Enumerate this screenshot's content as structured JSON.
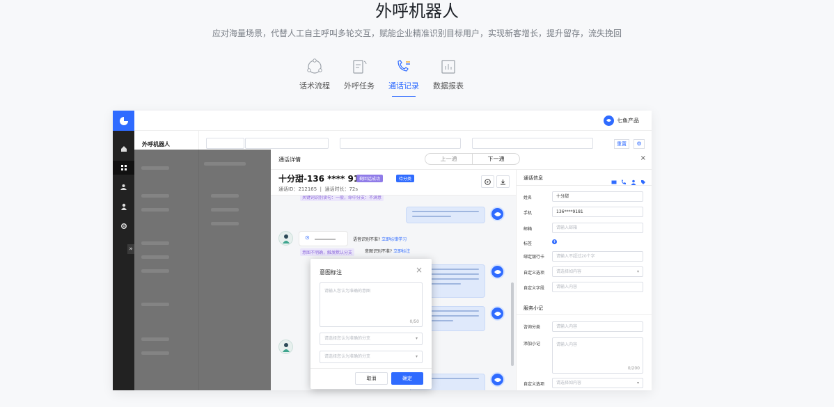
{
  "hero": {
    "title": "外呼机器人",
    "subtitle": "应对海量场景，代替人工自主呼叫多轮交互，赋能企业精准识别目标用户，实现新客增长，提升留存，流失挽回"
  },
  "feature_tabs": [
    {
      "label": "话术流程",
      "icon": "flow-icon"
    },
    {
      "label": "外呼任务",
      "icon": "task-icon"
    },
    {
      "label": "通话记录",
      "icon": "call-record-icon",
      "active": true
    },
    {
      "label": "数据报表",
      "icon": "report-icon"
    }
  ],
  "app": {
    "brand": "七鱼产品",
    "section_title": "外呼机器人",
    "reset_label": "重置",
    "accent": "#2f6bff"
  },
  "drawer": {
    "title": "通话详情",
    "prev": "上一通",
    "next": "下一通",
    "close": "×",
    "caller": "十分甜-136 **** 9181",
    "tag_identify": "剩回话成功",
    "tag_unclassified": "待分类",
    "call_id": "通话ID：212165",
    "sep": "|",
    "duration": "通话时长：72s"
  },
  "chat": {
    "keyword_tag": "关键词识别读句：一般，命中分支：不满意",
    "q1": "语音识别不准?",
    "q1_link": "立即标错学习",
    "intent_tag": "意图不明确，触发默认分支",
    "q2": "意图识别不准?",
    "q2_link": "立即标注"
  },
  "info_panel": {
    "header": "通话信息",
    "name_label": "姓名",
    "name_value": "十分甜",
    "phone_label": "手机",
    "phone_value": "136****9181",
    "email_label": "邮箱",
    "email_ph": "请输入邮箱",
    "tag_label": "标签",
    "bank_label": "绑定银行卡",
    "bank_ph": "请输入不超过20个字",
    "custom_opt_label": "自定义选项",
    "custom_opt_ph": "请选择如内容",
    "custom_field_label": "自定义字段",
    "custom_field_ph": "请输入内容",
    "service_header": "服务小记",
    "consult_label": "咨询分类",
    "consult_ph": "请输入内容",
    "note_label": "添加小记",
    "note_ph": "请输入内容",
    "note_count": "0/200",
    "custom_opt2_label": "自定义选项",
    "custom_opt2_ph": "请选择如内容"
  },
  "modal": {
    "title": "意图标注",
    "textarea_ph": "请输入您认为准确的意图",
    "count": "0/50",
    "select1_ph": "请选择您认为准确的分支",
    "select2_ph": "请选择您认为准确的分支",
    "cancel": "取消",
    "ok": "确定"
  }
}
